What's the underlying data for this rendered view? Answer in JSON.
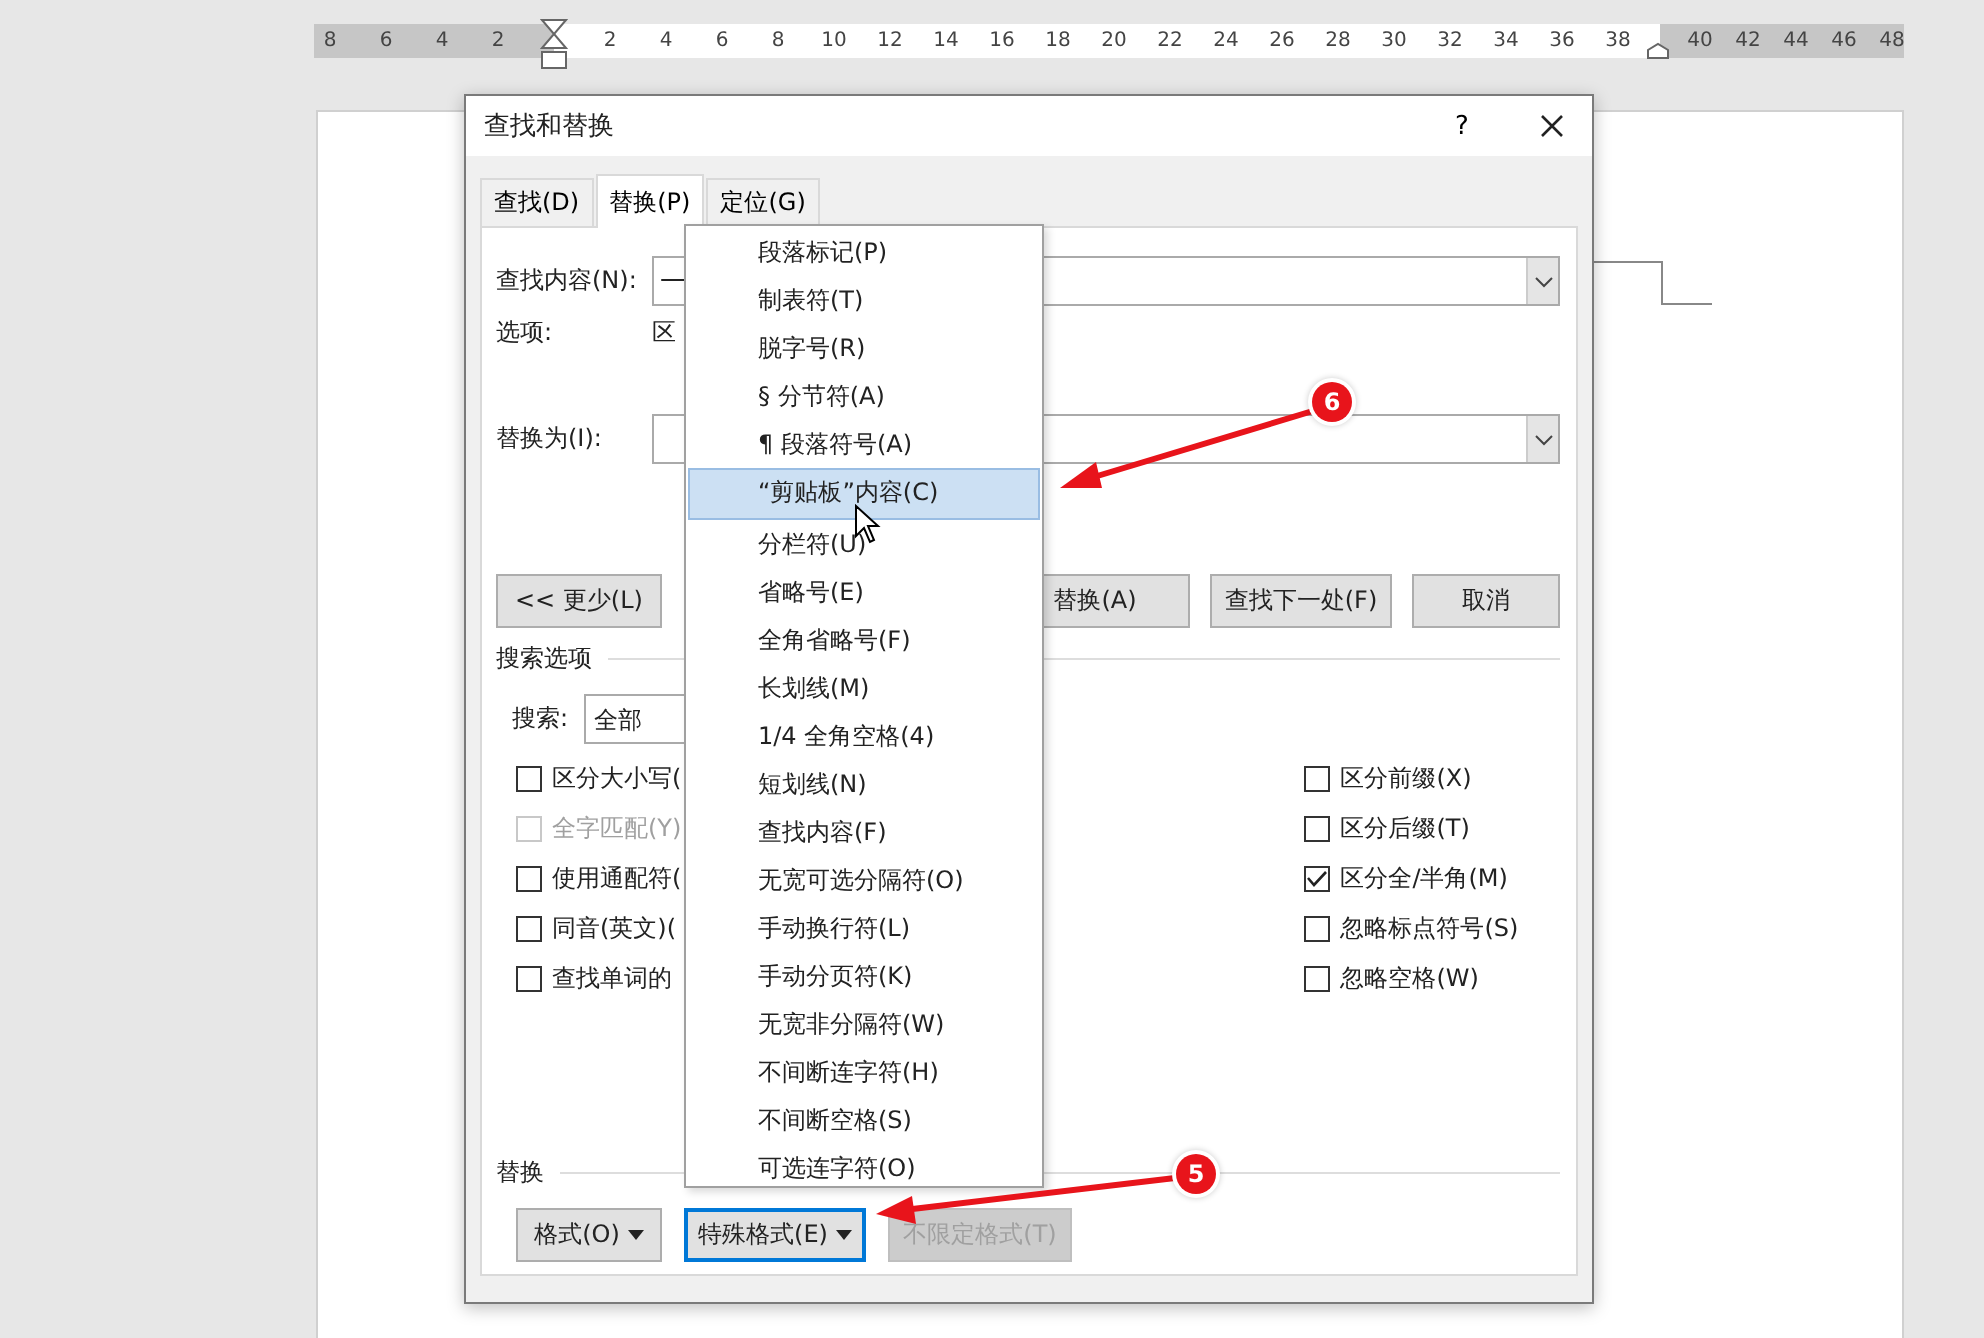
{
  "ruler": {
    "left_numbers": [
      "8",
      "6",
      "4",
      "2"
    ],
    "numbers": [
      "2",
      "4",
      "6",
      "8",
      "10",
      "12",
      "14",
      "16",
      "18",
      "20",
      "22",
      "24",
      "26",
      "28",
      "30",
      "32",
      "34",
      "36",
      "38"
    ],
    "right_numbers": [
      "40",
      "42",
      "44",
      "46",
      "48"
    ]
  },
  "dialog": {
    "title": "查找和替换",
    "help": "?",
    "tabs": [
      {
        "label": "查找(D)",
        "selected": false
      },
      {
        "label": "替换(P)",
        "selected": true
      },
      {
        "label": "定位(G)",
        "selected": false
      }
    ],
    "find_label": "查找内容(N):",
    "find_value": "一",
    "options_label": "选项:",
    "options_value": "区",
    "replace_label": "替换为(I):",
    "buttons": [
      {
        "label": "<< 更少(L)"
      },
      {
        "label": "替换(A)"
      },
      {
        "label": "查找下一处(F)"
      },
      {
        "label": "取消"
      }
    ],
    "search_options": {
      "title": "搜索选项",
      "search_label": "搜索:",
      "search_value": "全部",
      "left_checks": [
        {
          "label": "区分大小写(",
          "checked": false,
          "disabled": false
        },
        {
          "label": "全字匹配(Y)",
          "checked": false,
          "disabled": true
        },
        {
          "label": "使用通配符(",
          "checked": false,
          "disabled": false
        },
        {
          "label": "同音(英文)(",
          "checked": false,
          "disabled": false
        },
        {
          "label": "查找单词的",
          "checked": false,
          "disabled": false
        }
      ],
      "right_checks": [
        {
          "label": "区分前缀(X)",
          "checked": false,
          "disabled": false
        },
        {
          "label": "区分后缀(T)",
          "checked": false,
          "disabled": false
        },
        {
          "label": "区分全/半角(M)",
          "checked": true,
          "disabled": false
        },
        {
          "label": "忽略标点符号(S)",
          "checked": false,
          "disabled": false
        },
        {
          "label": "忽略空格(W)",
          "checked": false,
          "disabled": false
        }
      ]
    },
    "replace_section": {
      "title": "替换",
      "buttons": [
        {
          "label": "格式(O)",
          "dropdown": true,
          "focused": false,
          "disabled": false
        },
        {
          "label": "特殊格式(E)",
          "dropdown": true,
          "focused": true,
          "disabled": false
        },
        {
          "label": "不限定格式(T)",
          "dropdown": false,
          "focused": false,
          "disabled": true
        }
      ]
    },
    "menu": {
      "items": [
        {
          "label": "段落标记(P)",
          "selected": false
        },
        {
          "label": "制表符(T)",
          "selected": false
        },
        {
          "label": "脱字号(R)",
          "selected": false
        },
        {
          "label": "§ 分节符(A)",
          "selected": false
        },
        {
          "label": "¶ 段落符号(A)",
          "selected": false
        },
        {
          "label": "“剪贴板”内容(C)",
          "selected": true
        },
        {
          "label": "分栏符(U)",
          "selected": false
        },
        {
          "label": "省略号(E)",
          "selected": false
        },
        {
          "label": "全角省略号(F)",
          "selected": false
        },
        {
          "label": "长划线(M)",
          "selected": false
        },
        {
          "label": "1/4 全角空格(4)",
          "selected": false
        },
        {
          "label": "短划线(N)",
          "selected": false
        },
        {
          "label": "查找内容(F)",
          "selected": false
        },
        {
          "label": "无宽可选分隔符(O)",
          "selected": false
        },
        {
          "label": "手动换行符(L)",
          "selected": false
        },
        {
          "label": "手动分页符(K)",
          "selected": false
        },
        {
          "label": "无宽非分隔符(W)",
          "selected": false
        },
        {
          "label": "不间断连字符(H)",
          "selected": false
        },
        {
          "label": "不间断空格(S)",
          "selected": false
        },
        {
          "label": "可选连字符(O)",
          "selected": false
        }
      ]
    }
  },
  "callouts": [
    {
      "number": "6"
    },
    {
      "number": "5"
    }
  ]
}
